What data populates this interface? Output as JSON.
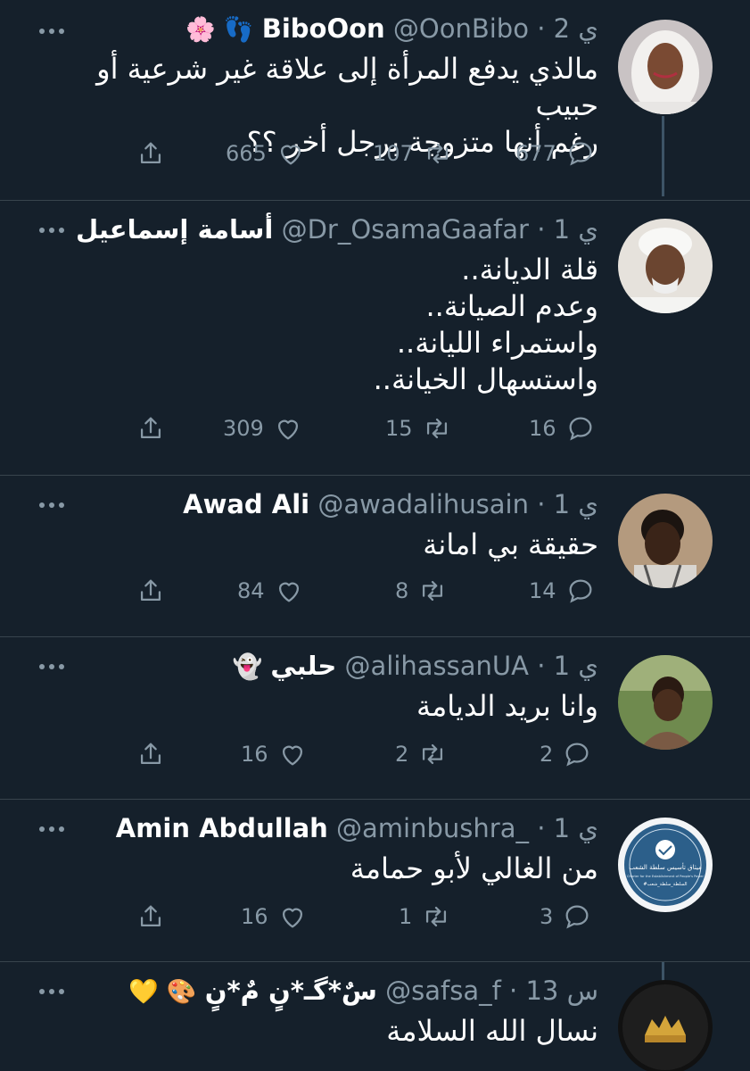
{
  "tweets": [
    {
      "name": "BiboOon",
      "emoji_after": "👣",
      "emoji_before": "🌸",
      "handle": "@OonBibo",
      "time": "2 ي",
      "text_lines": [
        "مالذي يدفع المرأة إلى علاقة غير شرعية أو حبيب",
        "رغم أنها متزوجة برجل أخر ؟؟"
      ],
      "replies": "677",
      "retweets": "107",
      "likes": "665"
    },
    {
      "name": "أسامة إسماعيل",
      "handle": "@Dr_OsamaGaafar",
      "time": "1 ي",
      "text_lines": [
        "قلة الديانة..",
        "وعدم الصيانة..",
        "واستمراء الليانة..",
        "واستسهال الخيانة.."
      ],
      "replies": "16",
      "retweets": "15",
      "likes": "309"
    },
    {
      "name": "Awad Ali",
      "handle": "@awadalihusain",
      "time": "1 ي",
      "text_lines": [
        "حقيقة بي امانة"
      ],
      "replies": "14",
      "retweets": "8",
      "likes": "84"
    },
    {
      "name": "حلبي",
      "emoji_after": "👻",
      "handle": "@alihassanUA",
      "time": "1 ي",
      "text_lines": [
        "وانا بريد الديامة"
      ],
      "replies": "2",
      "retweets": "2",
      "likes": "16"
    },
    {
      "name": "Amin Abdullah",
      "handle": "@aminbushra_",
      "time": "1 ي",
      "text_lines": [
        "من الغالي لأبو حمامة"
      ],
      "replies": "3",
      "retweets": "1",
      "likes": "16"
    },
    {
      "name": "سٌ*گـ*نٍ مٌ*نٍ",
      "emoji_after": "🎨",
      "emoji_before": "💛",
      "handle": "@safsa_f",
      "time": "13 س",
      "text_lines": [
        "نسال الله السلامة"
      ]
    }
  ],
  "separator": "·",
  "logo_text": {
    "line1": "ميثاق تأسيس سلطة الشعب",
    "line2": "Charter for the Establishment of People's Power",
    "line3": "#السلطة_سلطة_شعب"
  },
  "colors": {
    "background": "#15202b",
    "text": "#ffffff",
    "muted": "#8899a6",
    "divider": "#38444d"
  }
}
